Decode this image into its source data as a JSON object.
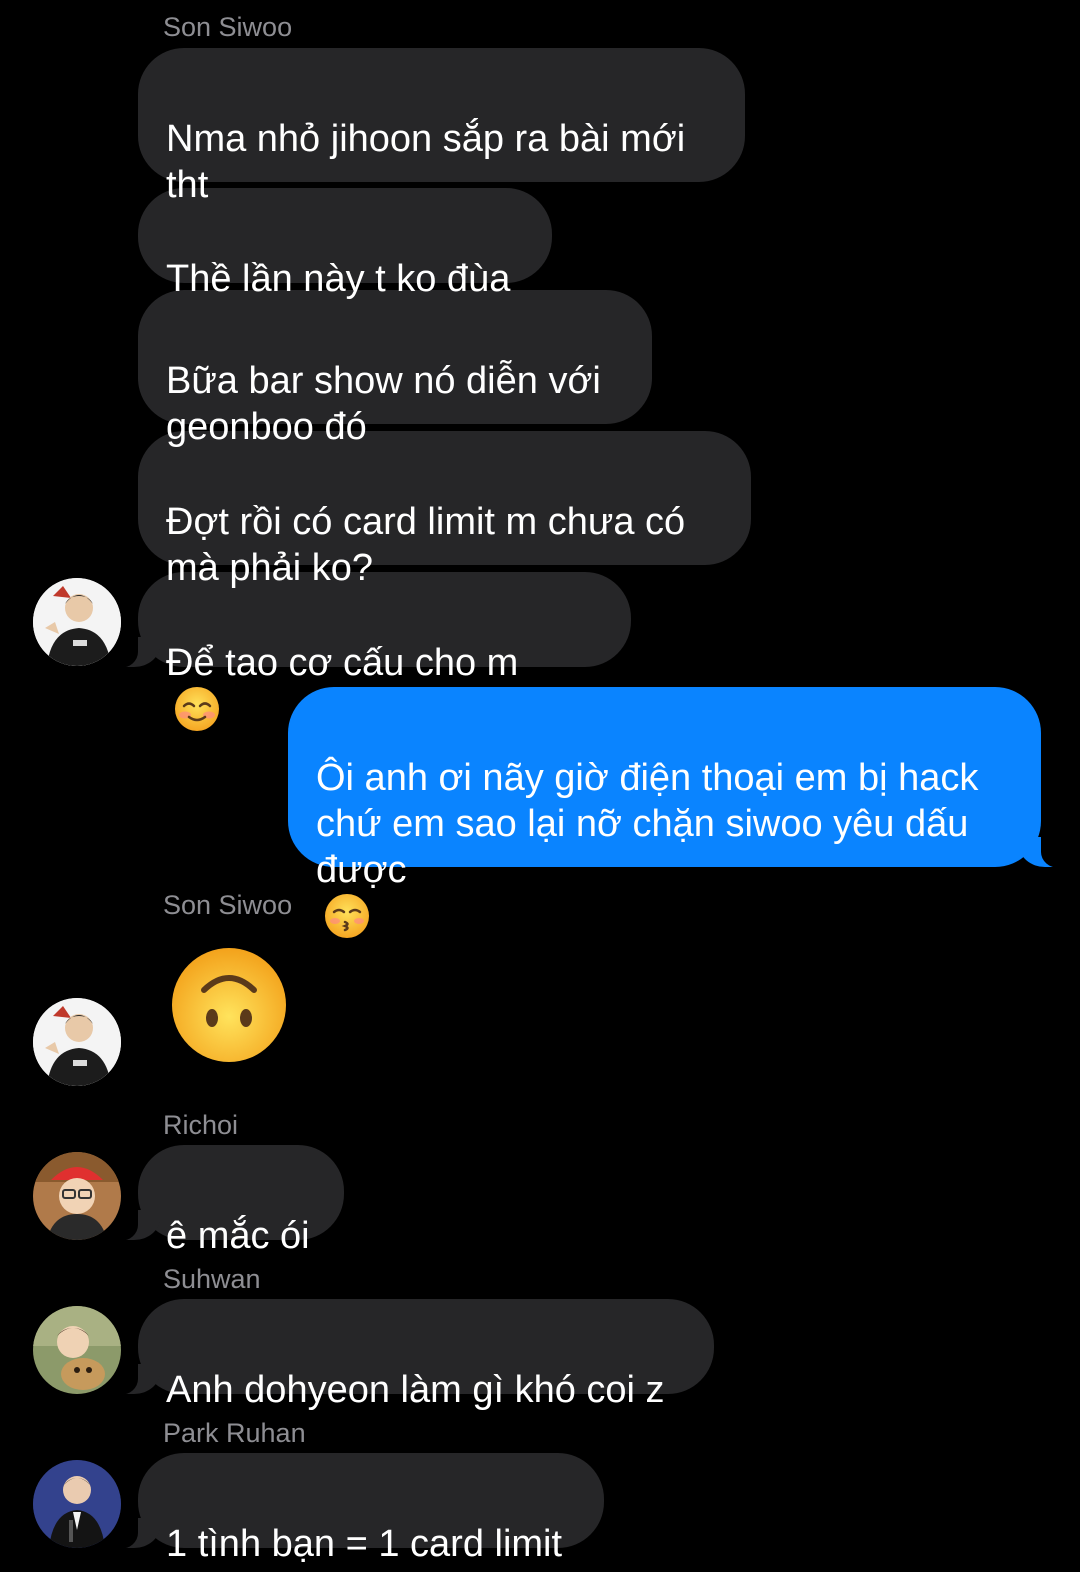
{
  "thread": {
    "senders": {
      "son_siwoo_1": "Son Siwoo",
      "son_siwoo_2": "Son Siwoo",
      "richoi": "Richoi",
      "suhwan": "Suhwan",
      "park_ruhan": "Park Ruhan"
    },
    "messages": {
      "m1": "Nma nhỏ jihoon sắp ra bài mới\ntht",
      "m2": "Thề lần này t ko đùa",
      "m3": "Bữa bar show nó diễn với\ngeonboo đó",
      "m4": "Đợt rồi có card limit m chưa có\nmà phải ko?",
      "m5": "Để tao cơ cấu cho m",
      "out1": "Ôi anh ơi nãy giờ điện thoại em bị hack\nchứ em sao lại nỡ chặn siwoo yêu dấu\nđược",
      "m6": "ê mắc ói",
      "m7": "Anh dohyeon làm gì khó coi z",
      "m8": "1 tình bạn = 1 card limit"
    },
    "emojis": {
      "m5_emoji": "smiling-face-icon",
      "out1_emoji": "kissing-face-icon",
      "standalone": "upside-down-face-icon"
    }
  },
  "colors": {
    "background": "#000000",
    "incoming_bubble": "#262628",
    "outgoing_bubble": "#0a84ff",
    "sender_name": "#8e8e93",
    "text": "#ffffff"
  }
}
